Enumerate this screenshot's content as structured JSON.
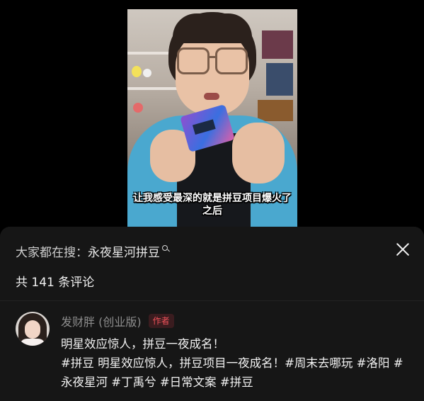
{
  "video": {
    "subtitle": "让我感受最深的就是拼豆项目爆火了之后"
  },
  "panel": {
    "search_label": "大家都在搜：",
    "search_keyword": "永夜星河拼豆",
    "comment_count_text": "共 141 条评论"
  },
  "comment": {
    "author": "发财胖 (创业版)",
    "badge": "作者",
    "line1": "明星效应惊人，拼豆一夜成名！",
    "line2": "#拼豆 明星效应惊人，拼豆项目一夜成名！#周末去哪玩 #洛阳 #永夜星河 #丁禹兮 #日常文案 #拼豆"
  },
  "icons": [
    "search-icon",
    "close-icon",
    "avatar"
  ],
  "colors": {
    "badge": "#f0525a",
    "panel_bg": "#161616",
    "video_shirt": "#4aa8cf"
  }
}
